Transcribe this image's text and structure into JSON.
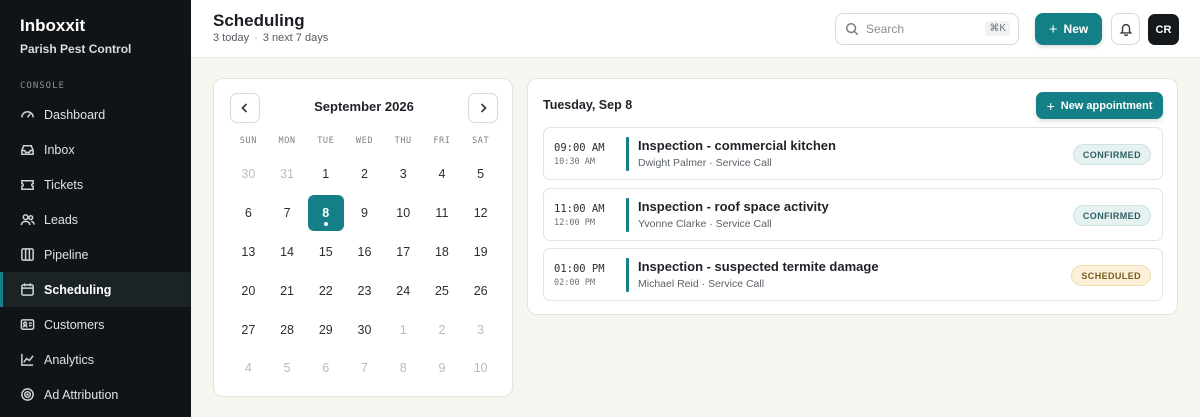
{
  "app": {
    "name": "Inboxxit",
    "org": "Parish Pest Control",
    "section": "CONSOLE"
  },
  "sidebar": {
    "items": [
      {
        "label": "Dashboard",
        "icon": "dashboard-icon"
      },
      {
        "label": "Inbox",
        "icon": "inbox-icon"
      },
      {
        "label": "Tickets",
        "icon": "ticket-icon"
      },
      {
        "label": "Leads",
        "icon": "users-icon"
      },
      {
        "label": "Pipeline",
        "icon": "pipeline-icon"
      },
      {
        "label": "Scheduling",
        "icon": "calendar-icon",
        "active": true
      },
      {
        "label": "Customers",
        "icon": "id-card-icon"
      },
      {
        "label": "Analytics",
        "icon": "chart-line-icon"
      },
      {
        "label": "Ad Attribution",
        "icon": "target-icon"
      }
    ]
  },
  "header": {
    "title": "Scheduling",
    "today": "3 today",
    "next": "3 next 7 days",
    "search_placeholder": "Search",
    "search_shortcut": "⌘K",
    "new_label": "New",
    "avatar_initials": "CR"
  },
  "calendar": {
    "month_label": "September 2026",
    "weekdays": [
      "SUN",
      "MON",
      "TUE",
      "WED",
      "THU",
      "FRI",
      "SAT"
    ],
    "days": [
      {
        "d": "30",
        "muted": true
      },
      {
        "d": "31",
        "muted": true
      },
      {
        "d": "1"
      },
      {
        "d": "2"
      },
      {
        "d": "3"
      },
      {
        "d": "4"
      },
      {
        "d": "5"
      },
      {
        "d": "6"
      },
      {
        "d": "7"
      },
      {
        "d": "8",
        "selected": true
      },
      {
        "d": "9"
      },
      {
        "d": "10"
      },
      {
        "d": "11"
      },
      {
        "d": "12"
      },
      {
        "d": "13"
      },
      {
        "d": "14"
      },
      {
        "d": "15"
      },
      {
        "d": "16"
      },
      {
        "d": "17"
      },
      {
        "d": "18"
      },
      {
        "d": "19"
      },
      {
        "d": "20"
      },
      {
        "d": "21"
      },
      {
        "d": "22"
      },
      {
        "d": "23"
      },
      {
        "d": "24"
      },
      {
        "d": "25"
      },
      {
        "d": "26"
      },
      {
        "d": "27"
      },
      {
        "d": "28"
      },
      {
        "d": "29"
      },
      {
        "d": "30"
      },
      {
        "d": "1",
        "muted": true
      },
      {
        "d": "2",
        "muted": true
      },
      {
        "d": "3",
        "muted": true
      },
      {
        "d": "4",
        "muted": true
      },
      {
        "d": "5",
        "muted": true
      },
      {
        "d": "6",
        "muted": true
      },
      {
        "d": "7",
        "muted": true
      },
      {
        "d": "8",
        "muted": true
      },
      {
        "d": "9",
        "muted": true
      },
      {
        "d": "10",
        "muted": true
      }
    ]
  },
  "agenda": {
    "date_label": "Tuesday, Sep 8",
    "new_appointment_label": "New appointment",
    "appointments": [
      {
        "start": "09:00 AM",
        "end": "10:30 AM",
        "title": "Inspection - commercial kitchen",
        "meta": "Dwight Palmer · Service Call",
        "status": "CONFIRMED",
        "status_kind": "confirmed"
      },
      {
        "start": "11:00 AM",
        "end": "12:00 PM",
        "title": "Inspection - roof space activity",
        "meta": "Yvonne Clarke · Service Call",
        "status": "CONFIRMED",
        "status_kind": "confirmed"
      },
      {
        "start": "01:00 PM",
        "end": "02:00 PM",
        "title": "Inspection - suspected termite damage",
        "meta": "Michael Reid · Service Call",
        "status": "SCHEDULED",
        "status_kind": "scheduled"
      }
    ]
  },
  "colors": {
    "accent": "#147f86",
    "sidebar_bg": "#111416",
    "page_bg": "#f7f5f0"
  }
}
